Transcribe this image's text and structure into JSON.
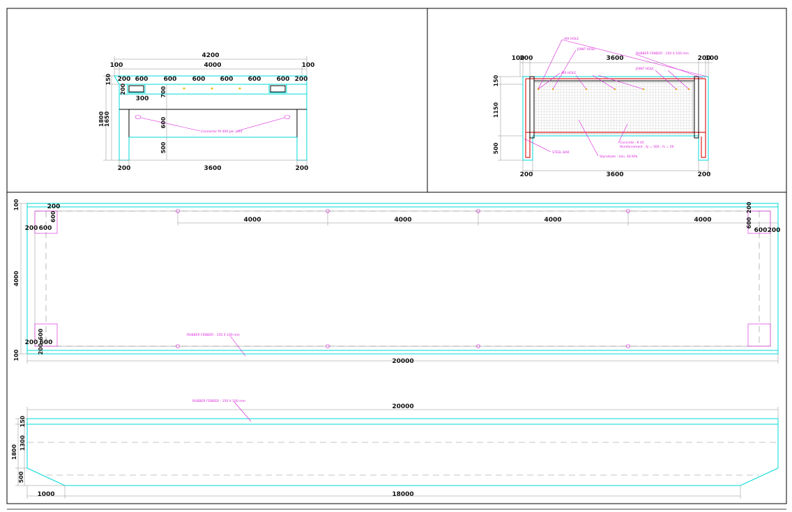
{
  "elevation_view": {
    "dims": {
      "overall": "4200",
      "inner": "4000",
      "end_left": "100",
      "end_right": "100",
      "left_block": "200",
      "seg1": "600",
      "seg2": "600",
      "seg3": "600",
      "seg4": "600",
      "seg5": "600",
      "seg6": "600",
      "right_block": "200",
      "top_h": "150",
      "opening_h": "200",
      "opening_w": "300",
      "beam_h": "700",
      "mid_h": "600",
      "leg_h": "500",
      "total_h1": "1800",
      "total_h2": "1650",
      "bottom_left": "200",
      "bottom_span": "3600",
      "bottom_right": "200"
    },
    "note": "Connector fit 400 per joint"
  },
  "section_view": {
    "dims": {
      "left_a": "100",
      "left_b": "200",
      "span": "3600",
      "right_a": "200",
      "right_b": "100",
      "top_h": "150",
      "mid_h": "1150",
      "leg_h": "500",
      "bottom_left": "200",
      "bottom_span": "3600",
      "bottom_right": "200"
    },
    "notes": {
      "air_hole_top": "AIR HOLE",
      "joint_hole_left": "JOINT HOLE",
      "air_hole_mid": "AIR HOLE",
      "rubber_fender": "RUBBER FENDER : 150 X 100 mm",
      "joint_hole_right": "JOINT HOLE",
      "concrete": "Concrete : K 45",
      "reinforcement": "Reinforcement : fy = 500 ; fc = 50",
      "steel_bar": "STEEL BAR",
      "styrofoam": "Styrofoam : min. 40 KPa"
    }
  },
  "plan_view": {
    "dims": {
      "top_edge": "100",
      "bottom_edge": "100",
      "height": "4000",
      "length": "20000",
      "spacing1": "4000",
      "spacing2": "4000",
      "spacing3": "4000",
      "spacing4": "4000",
      "tl_200": "200",
      "tl_600": "600",
      "tl_600b": "600",
      "tl_200b": "200",
      "tr_200": "200",
      "tr_600": "600",
      "tr_600b": "600",
      "tr_200b": "200",
      "bl_200": "200",
      "bl_600": "600",
      "bl_600b": "600",
      "bl_200b": "200"
    },
    "note": "RUBBER FENDER : 150 X 100 mm"
  },
  "long_section": {
    "dims": {
      "length": "20000",
      "top_h": "150",
      "mid_h": "1300",
      "total_h": "1800",
      "leg_h": "500",
      "taper": "1000",
      "bottom": "18000"
    },
    "note": "RUBBER FENDER : 150 X 100 mm"
  },
  "colors": {
    "outline": "#00d8d8",
    "annotation": "#d81bd8",
    "dimension": "#8c8c8c",
    "frame": "#000000",
    "rebar": "#e02020"
  }
}
